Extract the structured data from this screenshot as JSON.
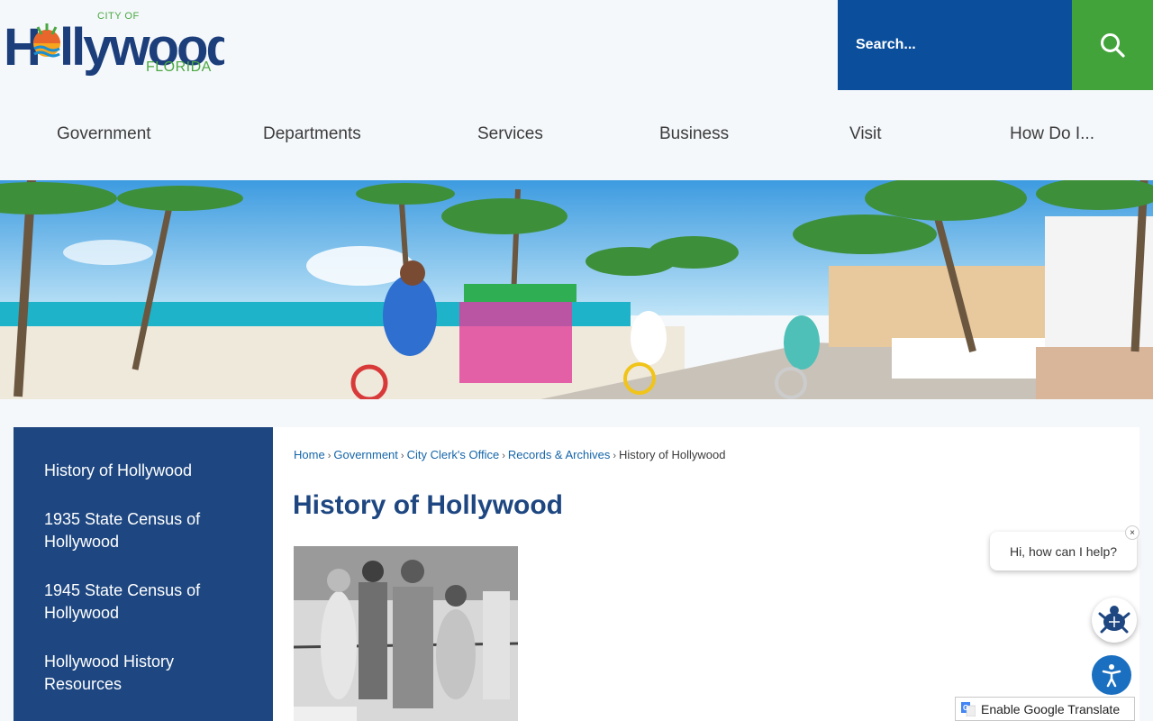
{
  "header": {
    "logo": {
      "city_of": "CITY OF",
      "word": "Hollywood",
      "state": "FLORIDA"
    },
    "search": {
      "placeholder": "Search..."
    },
    "search_icon": "search-icon"
  },
  "nav": {
    "items": [
      {
        "label": "Government"
      },
      {
        "label": "Departments"
      },
      {
        "label": "Services"
      },
      {
        "label": "Business"
      },
      {
        "label": "Visit"
      },
      {
        "label": "How Do I..."
      }
    ]
  },
  "sidebar": {
    "items": [
      {
        "label": "History of Hollywood"
      },
      {
        "label": "1935 State Census of Hollywood"
      },
      {
        "label": "1945 State Census of Hollywood"
      },
      {
        "label": "Hollywood History Resources"
      }
    ]
  },
  "breadcrumb": {
    "items": [
      "Home",
      "Government",
      "City Clerk's Office",
      "Records & Archives"
    ],
    "current": "History of Hollywood",
    "separator": "›"
  },
  "page": {
    "title": "History of Hollywood"
  },
  "chat": {
    "greeting": "Hi, how can I help?",
    "close": "×"
  },
  "translate": {
    "label": "Enable Google Translate"
  },
  "colors": {
    "brand_blue": "#1e4781",
    "search_blue": "#0b4f9c",
    "search_green": "#43a33b",
    "link_blue": "#1565a8"
  }
}
